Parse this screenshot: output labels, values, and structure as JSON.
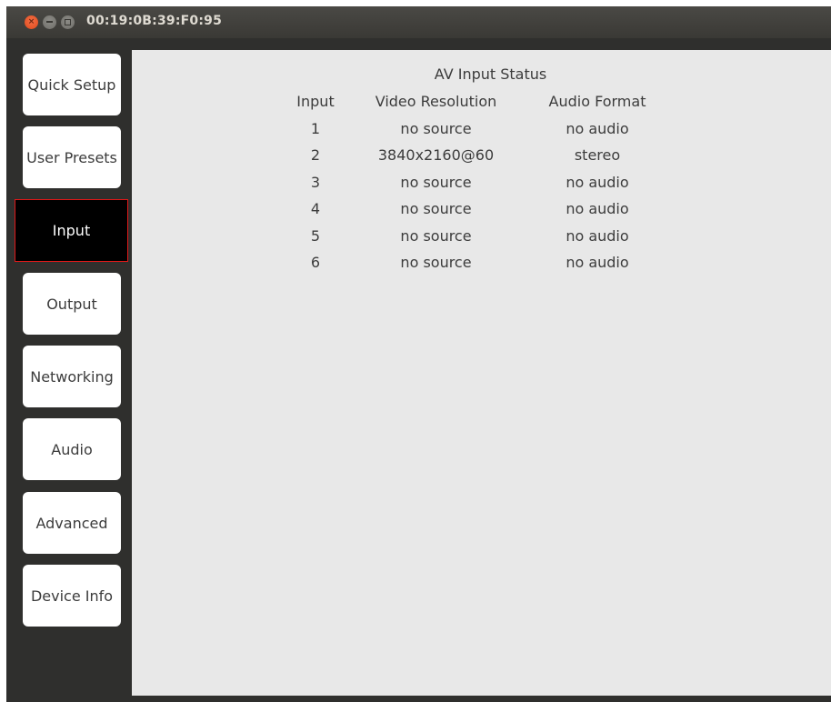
{
  "window": {
    "title": "00:19:0B:39:F0:95",
    "controls": {
      "close": "×",
      "minimize": "",
      "maximize": ""
    }
  },
  "sidebar": {
    "items": [
      {
        "label": "Quick Setup",
        "active": false
      },
      {
        "label": "User Presets",
        "active": false
      },
      {
        "label": "Input",
        "active": true
      },
      {
        "label": "Output",
        "active": false
      },
      {
        "label": "Networking",
        "active": false
      },
      {
        "label": "Audio",
        "active": false
      },
      {
        "label": "Advanced",
        "active": false
      },
      {
        "label": "Device Info",
        "active": false
      }
    ]
  },
  "status": {
    "title": "AV Input Status",
    "columns": [
      "Input",
      "Video Resolution",
      "Audio Format"
    ],
    "rows": [
      [
        "1",
        "no source",
        "no audio"
      ],
      [
        "2",
        "3840x2160@60",
        "stereo"
      ],
      [
        "3",
        "no source",
        "no audio"
      ],
      [
        "4",
        "no source",
        "no audio"
      ],
      [
        "5",
        "no source",
        "no audio"
      ],
      [
        "6",
        "no source",
        "no audio"
      ]
    ]
  },
  "colors": {
    "active_nav_border": "#e01818",
    "active_nav_bg": "#000000",
    "panel_bg": "#e8e8e8",
    "chrome_bg": "#2f2f2d",
    "close_button": "#e95420"
  }
}
